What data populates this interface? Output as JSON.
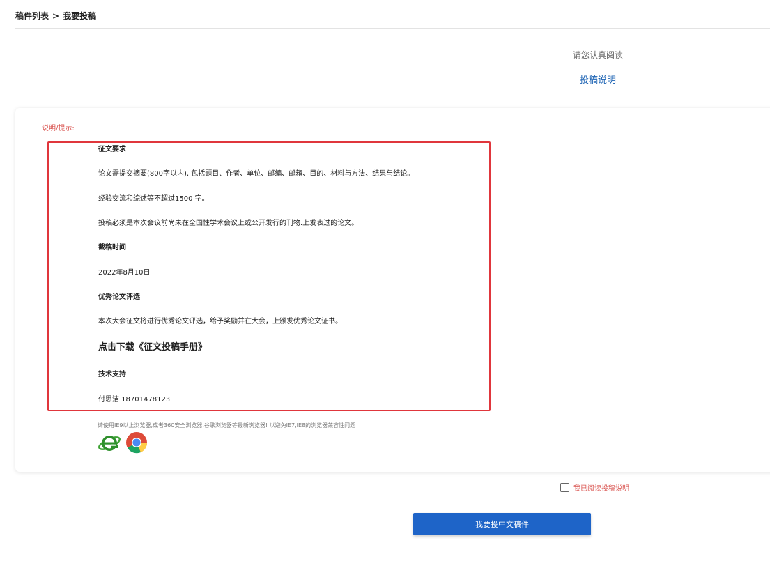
{
  "breadcrumb": {
    "parent": "稿件列表",
    "separator": ">",
    "current": "我要投稿"
  },
  "guide": {
    "hint": "请您认真阅读",
    "link_text": "投稿说明"
  },
  "notice": {
    "label": "说明/提示:",
    "heading_requirements": "征文要求",
    "line_abstract": "论文需提交摘要(800字以内), 包括题目、作者、单位、邮编、邮箱、目的、材料与方法、结果与结论。",
    "line_length": "经验交流和综述等不超过1500 字。",
    "line_original": "投稿必须是本次会议前尚未在全国性学术会议上或公开发行的刊物.上发表过的论文。",
    "heading_deadline": "截稿时间",
    "deadline_date": "2022年8月10日",
    "heading_award": "优秀论文评选",
    "line_award": "本次大会征文将进行优秀论文评选，给予奖励并在大会，上颁发优秀论文证书。",
    "download_link": "点击下载《征文投稿手册》",
    "heading_support": "技术支持",
    "support_contact": "付思洁 18701478123"
  },
  "browser": {
    "note": "请使用IE9以上浏览器,或者360安全浏览器,谷歌浏览器等最新浏览器! 以避免IE7,IE8的浏览器兼容性问题",
    "icons": [
      "ie-icon",
      "chrome-icon"
    ]
  },
  "agreement": {
    "checkbox_label": "我已阅读投稿说明",
    "checked": false
  },
  "actions": {
    "submit_label": "我要投中文稿件"
  },
  "colors": {
    "accent_blue": "#1e64c8",
    "link_blue": "#1e64b4",
    "highlight_red": "#e0363c",
    "notice_red": "#d9534f"
  }
}
